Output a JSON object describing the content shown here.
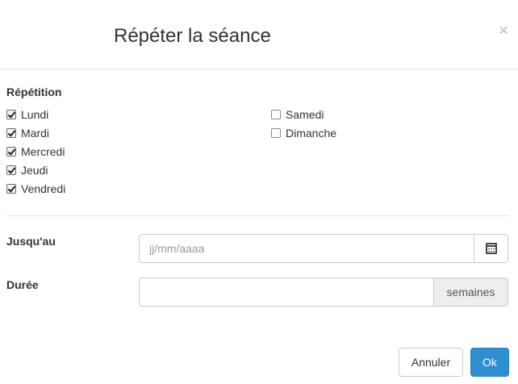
{
  "dialog": {
    "title": "Répéter la séance",
    "close_glyph": "×"
  },
  "repetition": {
    "label": "Répétition",
    "days": [
      {
        "label": "Lundi",
        "checked": true
      },
      {
        "label": "Mardi",
        "checked": true
      },
      {
        "label": "Mercredi",
        "checked": true
      },
      {
        "label": "Jeudi",
        "checked": true
      },
      {
        "label": "Vendredi",
        "checked": true
      },
      {
        "label": "Samedi",
        "checked": false
      },
      {
        "label": "Dimanche",
        "checked": false
      }
    ]
  },
  "until": {
    "label": "Jusqu'au",
    "value": "",
    "placeholder": "jj/mm/aaaa",
    "icon": "calendar-icon"
  },
  "duration": {
    "label": "Durée",
    "value": "",
    "unit": "semaines"
  },
  "footer": {
    "cancel_label": "Annuler",
    "ok_label": "Ok"
  },
  "colors": {
    "primary": "#2f8fd0",
    "border": "#cccccc",
    "addon_bg": "#eeeeee",
    "placeholder": "#999999"
  }
}
